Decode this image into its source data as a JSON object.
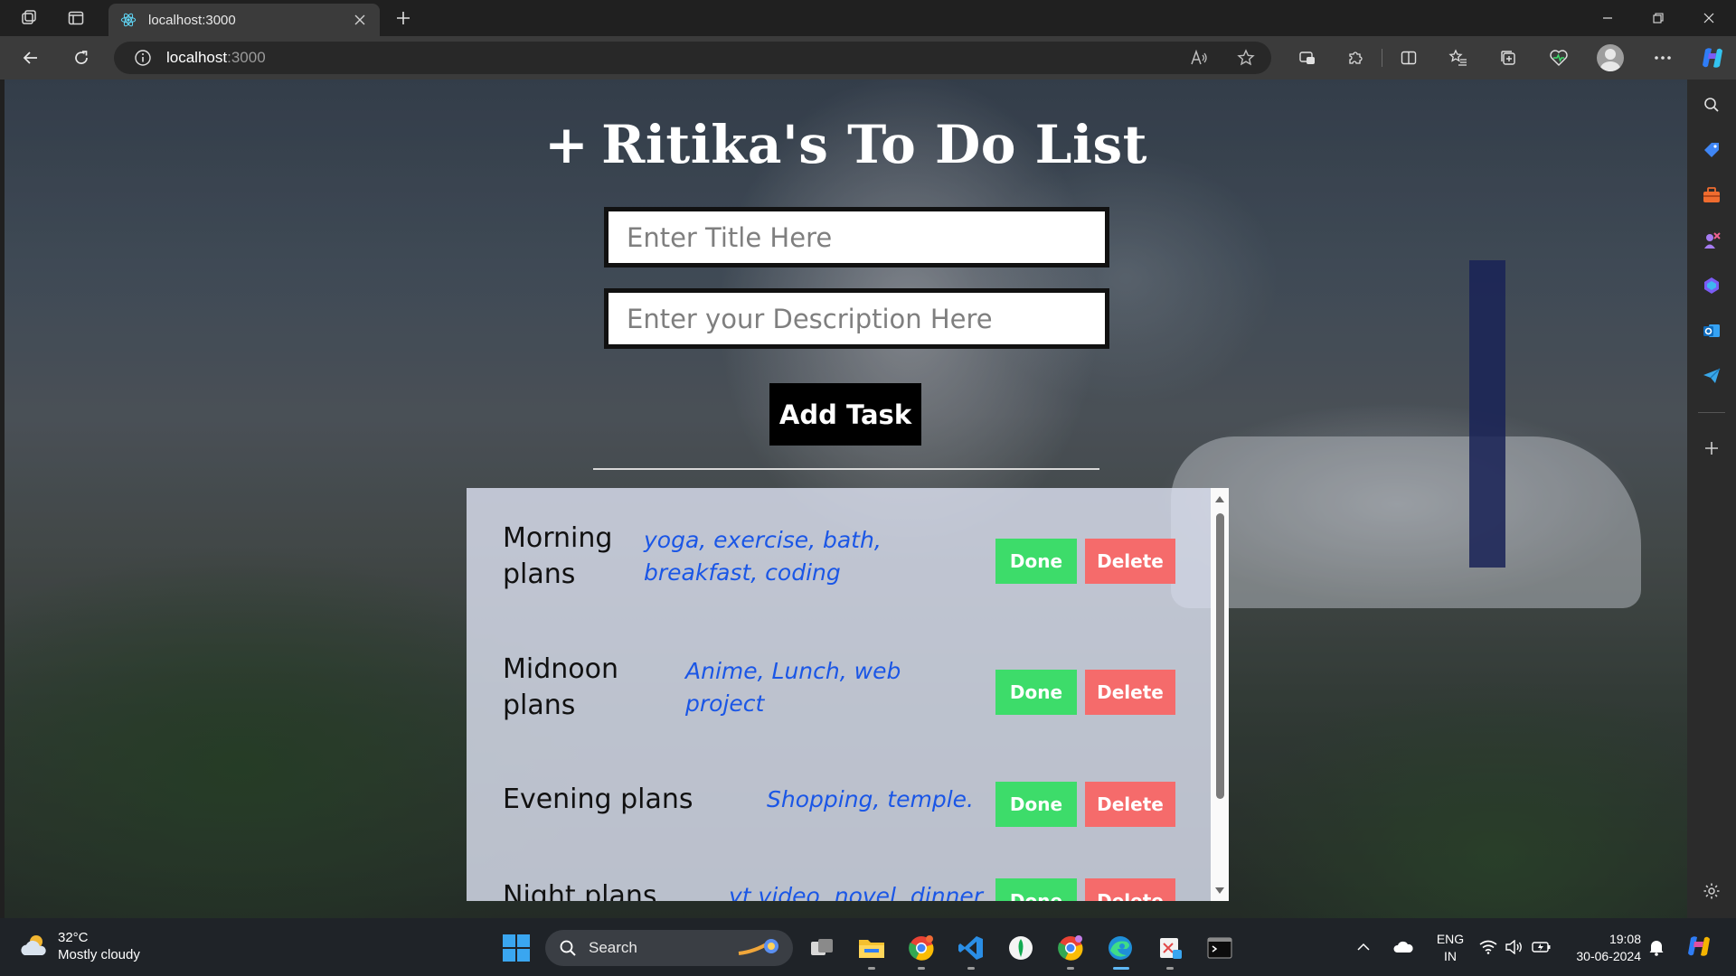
{
  "browser": {
    "tab_title": "localhost:3000",
    "url_host": "localhost",
    "url_port": ":3000"
  },
  "app": {
    "title_plus": "+",
    "title": "Ritika's To Do List",
    "title_placeholder": "Enter Title Here",
    "description_placeholder": "Enter your Description Here",
    "add_button": "Add Task",
    "done_label": "Done",
    "delete_label": "Delete",
    "tasks": [
      {
        "title": "Morning plans",
        "description": "yoga, exercise, bath, breakfast, coding"
      },
      {
        "title": "Midnoon plans",
        "description": "Anime, Lunch, web project"
      },
      {
        "title": "Evening plans",
        "description": "Shopping, temple."
      },
      {
        "title": "Night plans",
        "description": "yt video, novel, dinner"
      }
    ]
  },
  "taskbar": {
    "weather_temp": "32°C",
    "weather_desc": "Mostly cloudy",
    "search_label": "Search",
    "lang_primary": "ENG",
    "lang_secondary": "IN",
    "time": "19:08",
    "date": "30-06-2024"
  },
  "colors": {
    "done": "#3ddc6a",
    "delete": "#f56b6b",
    "description_text": "#1a56e6"
  }
}
